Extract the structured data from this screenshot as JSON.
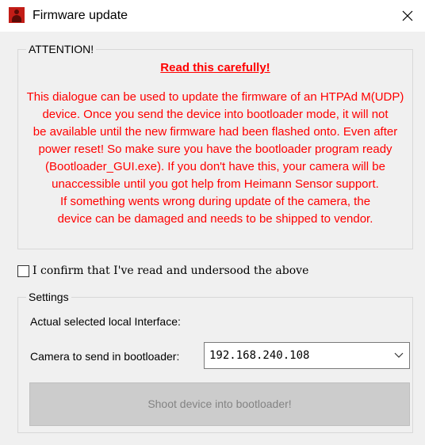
{
  "window": {
    "title": "Firmware update",
    "icon": "heimann-app-icon",
    "close_icon": "close-icon"
  },
  "attention": {
    "legend": "ATTENTION!",
    "heading": "Read this carefully!",
    "lines": [
      "This dialogue can be used to update the firmware of an HTPAd M(UDP)",
      "device. Once you send the device into bootloader mode, it will not",
      "be available until the new firmware had been flashed onto. Even after",
      "power reset! So make sure you have the bootloader program ready",
      "(Bootloader_GUI.exe). If you don't have this, your camera will be",
      "unaccessible until you  got help from Heimann Sensor support.",
      "If something wents wrong during update of the camera, the",
      "device can be damaged and needs to be shipped to vendor."
    ],
    "text_color": "#ff0000"
  },
  "confirm": {
    "label": "I confirm that I've read and undersood the above",
    "checked": false
  },
  "settings": {
    "legend": "Settings",
    "interface_label": "Actual selected local Interface:",
    "camera_label": "Camera to send in bootloader:",
    "camera_value": "192.168.240.108",
    "shoot_button_label": "Shoot device into bootloader!",
    "shoot_button_enabled": false
  }
}
